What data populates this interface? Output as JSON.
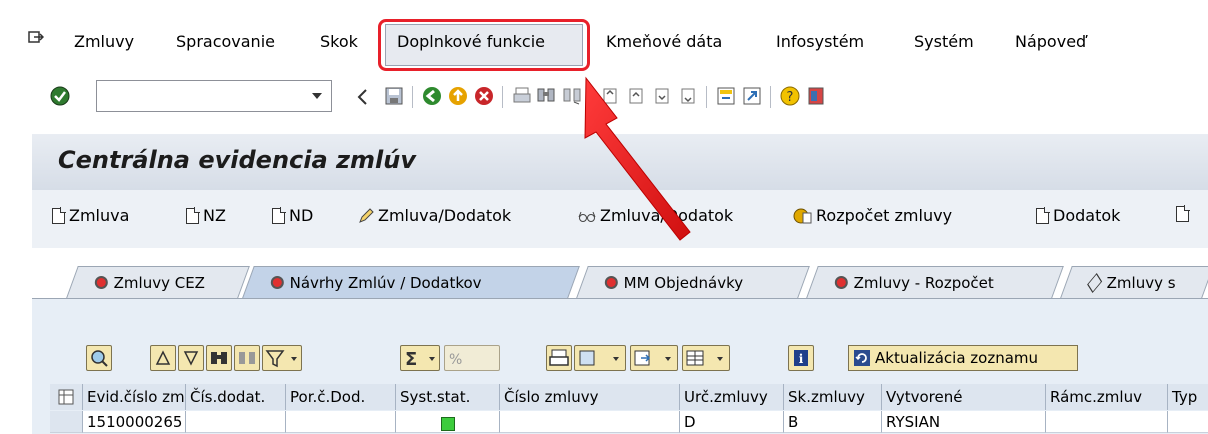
{
  "menubar": {
    "items": [
      "Zmluvy",
      "Spracovanie",
      "Skok",
      "Doplnkové funkcie",
      "Kmeňové dáta",
      "Infosystém",
      "Systém",
      "Nápoveď"
    ],
    "active_item": "Doplnkové funkcie"
  },
  "toolbar": {
    "command_field_value": ""
  },
  "screen": {
    "title": "Centrálna evidencia zmlúv"
  },
  "app_toolbar": {
    "buttons": [
      "Zmluva",
      "NZ",
      "ND",
      "Zmluva/Dodatok",
      "Zmluva/Dodatok",
      "Rozpočet zmluvy",
      "Dodatok"
    ]
  },
  "tabs": {
    "items": [
      "Zmluvy CEZ",
      "Návrhy Zmlúv / Dodatkov",
      "MM Objednávky",
      "Zmluvy - Rozpočet",
      "Zmluvy s"
    ],
    "active": "Návrhy Zmlúv / Dodatkov"
  },
  "alv_toolbar": {
    "refresh_label": "Aktualizácia zoznamu"
  },
  "grid": {
    "columns": [
      "Evid.číslo zml.",
      "Čís.dodat.",
      "Por.č.Dod.",
      "Syst.stat.",
      "Číslo zmluvy",
      "Urč.zmluvy",
      "Sk.zmluvy",
      "Vytvorené",
      "Rámc.zmluv",
      "Typ"
    ],
    "rows": [
      {
        "evid": "1510000265",
        "cis_dodat": "",
        "por_dod": "",
        "syst_stat": "green",
        "cislo_zmluvy": "",
        "urc": "D",
        "sk": "B",
        "vytvorene": "RYSIAN",
        "ramc": "",
        "typ": ""
      }
    ]
  },
  "colors": {
    "highlight": "#e8202a",
    "status_green": "#3ccc3c",
    "tab_active": "#c3d3e8"
  }
}
